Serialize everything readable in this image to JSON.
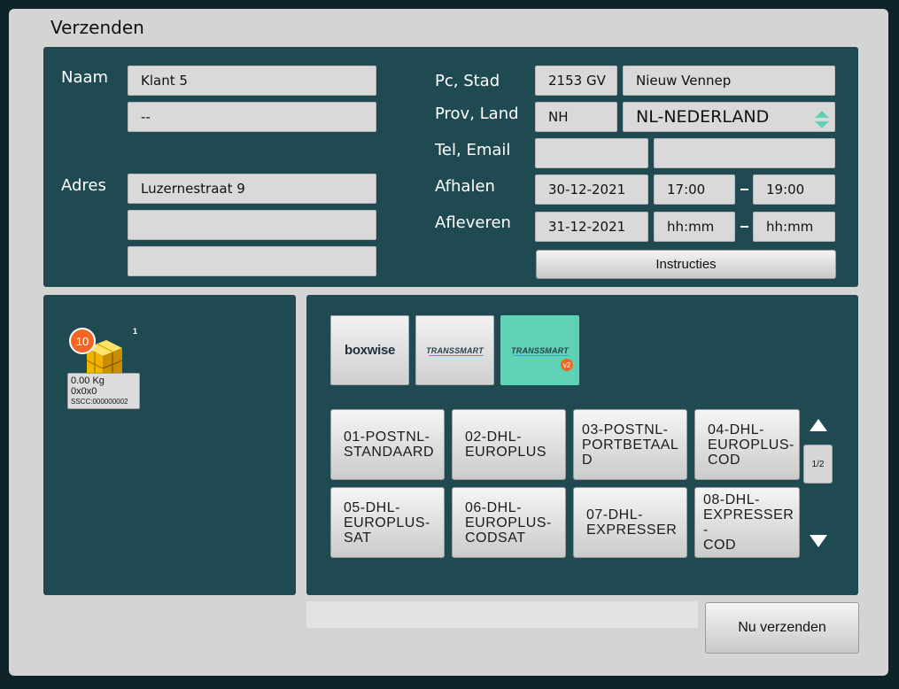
{
  "window": {
    "title": "Verzenden"
  },
  "address": {
    "name_label": "Naam",
    "name_value": "Klant 5",
    "name2_value": "--",
    "address_label": "Adres",
    "address_line1": "Luzernestraat 9",
    "address_line2": "",
    "address_line3": ""
  },
  "location": {
    "pc_city_label": "Pc, Stad",
    "postcode": "2153 GV",
    "city": "Nieuw Vennep",
    "prov_country_label": "Prov, Land",
    "province": "NH",
    "country": "NL-NEDERLAND",
    "tel_email_label": "Tel, Email",
    "tel": "",
    "email": ""
  },
  "schedule": {
    "pickup_label": "Afhalen",
    "pickup_date": "30-12-2021",
    "pickup_from": "17:00",
    "pickup_to": "19:00",
    "delivery_label": "Afleveren",
    "delivery_date": "31-12-2021",
    "delivery_from": "hh:mm",
    "delivery_to": "hh:mm",
    "instructions_label": "Instructies"
  },
  "package": {
    "badge_count": "10",
    "index": "1",
    "weight": "0.00 Kg",
    "dimensions": "0x0x0",
    "sscc": "SSCC:000000002"
  },
  "carriers": [
    {
      "label": "boxwise",
      "active": false
    },
    {
      "label": "TRANSSMART",
      "active": false
    },
    {
      "label": "TRANSSMART",
      "version": "v2",
      "active": true
    }
  ],
  "services": [
    {
      "label": "01-POSTNL-\nSTANDAARD"
    },
    {
      "label": "02-DHL-\nEUROPLUS"
    },
    {
      "label": "03-POSTNL-\nPORTBETAAL\nD"
    },
    {
      "label": "04-DHL-\nEUROPLUS-\nCOD"
    },
    {
      "label": "05-DHL-\nEUROPLUS-\nSAT"
    },
    {
      "label": "06-DHL-\nEUROPLUS-\nCODSAT"
    },
    {
      "label": "07-DHL-\nEXPRESSER"
    },
    {
      "label": "08-DHL-\nEXPRESSER-\nCOD"
    }
  ],
  "pagination": {
    "page": "1/2"
  },
  "footer": {
    "status_text": "",
    "send_label": "Nu verzenden"
  },
  "colors": {
    "panel": "#204a52",
    "accent": "#5fd1b5",
    "badge": "#f26522",
    "box": "#f0b400"
  }
}
